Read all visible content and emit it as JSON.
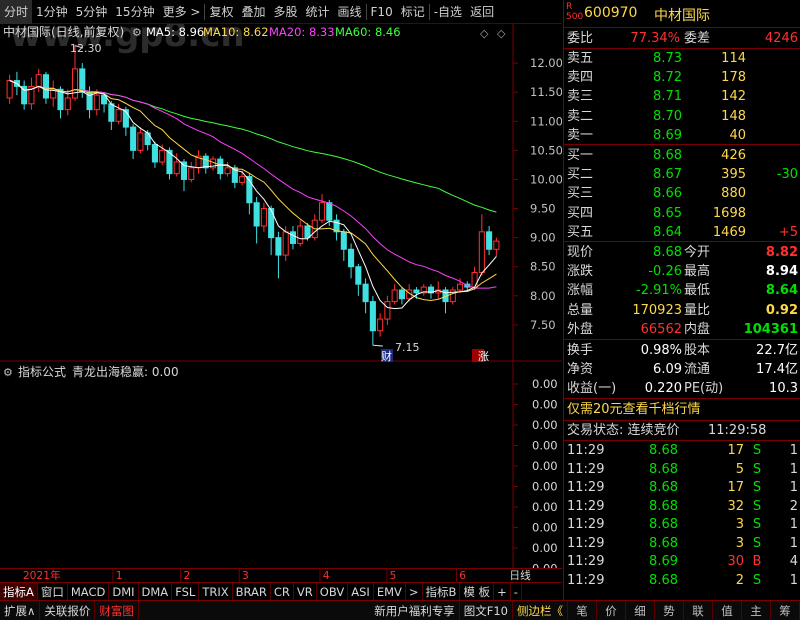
{
  "toolbar": {
    "items": [
      "分时",
      "1分钟",
      "5分钟",
      "15分钟",
      "更多 >",
      "复权",
      "叠加",
      "多股",
      "统计",
      "画线",
      "F10",
      "标记",
      "-自选",
      "返回"
    ]
  },
  "chart_title": {
    "name": "中材国际(日线,前复权)",
    "ma5": "MA5: 8.96",
    "ma10": "MA10: 8.62",
    "ma20": "MA20: 8.33",
    "ma60": "MA60: 8.46",
    "watermark": "www.gp8.cn"
  },
  "colors": {
    "up": "#ff3030",
    "down": "#40e0e0",
    "ma5": "#ffffff",
    "ma10": "#ffd84a",
    "ma20": "#ff40ff",
    "ma60": "#40ff40",
    "grid": "#7a0000"
  },
  "price_axis": [
    "12.00",
    "11.50",
    "11.00",
    "10.50",
    "10.00",
    "9.50",
    "9.00",
    "8.50",
    "8.00",
    "7.50"
  ],
  "annotations": {
    "high": "12.30",
    "low": "7.15",
    "badge_cai": "财",
    "badge_zhang": "涨"
  },
  "indicator": {
    "title": "指标公式",
    "formula": "青龙出海稳赢: 0.00",
    "axis": [
      "0.00",
      "0.00",
      "0.00",
      "0.00",
      "0.00",
      "0.00",
      "0.00",
      "0.00",
      "0.00",
      "0.00"
    ]
  },
  "date_axis": {
    "year": "2021年",
    "months": [
      "1",
      "2",
      "3",
      "4",
      "5",
      "6"
    ],
    "period": "日线"
  },
  "tabs": [
    "指标A",
    "窗口",
    "MACD",
    "DMI",
    "DMA",
    "FSL",
    "TRIX",
    "BRAR",
    "CR",
    "VR",
    "OBV",
    "ASI",
    "EMV",
    ">",
    "指标B",
    "模 板",
    "+",
    "-"
  ],
  "bottombar": {
    "items": [
      "扩展∧",
      "关联报价",
      "财富图"
    ],
    "right_items": [
      "新用户福利专享",
      "图文F10",
      "侧边栏《"
    ],
    "icons": [
      "笔",
      "价",
      "细",
      "势",
      "联",
      "值",
      "主",
      "筹"
    ]
  },
  "quote": {
    "rating_top": "R",
    "rating_bottom": "500",
    "code": "600970",
    "name": "中材国际",
    "weibi_label": "委比",
    "weibi": "77.34%",
    "weicha_label": "委差",
    "weicha": "4246",
    "sells": [
      {
        "label": "卖五",
        "price": "8.73",
        "vol": "114",
        "chg": ""
      },
      {
        "label": "卖四",
        "price": "8.72",
        "vol": "178",
        "chg": ""
      },
      {
        "label": "卖三",
        "price": "8.71",
        "vol": "142",
        "chg": ""
      },
      {
        "label": "卖二",
        "price": "8.70",
        "vol": "148",
        "chg": ""
      },
      {
        "label": "卖一",
        "price": "8.69",
        "vol": "40",
        "chg": ""
      }
    ],
    "buys": [
      {
        "label": "买一",
        "price": "8.68",
        "vol": "426",
        "chg": ""
      },
      {
        "label": "买二",
        "price": "8.67",
        "vol": "395",
        "chg": "-30"
      },
      {
        "label": "买三",
        "price": "8.66",
        "vol": "880",
        "chg": ""
      },
      {
        "label": "买四",
        "price": "8.65",
        "vol": "1698",
        "chg": ""
      },
      {
        "label": "买五",
        "price": "8.64",
        "vol": "1469",
        "chg": "+5"
      }
    ],
    "stats": [
      {
        "l1": "现价",
        "v1": "8.68",
        "l2": "今开",
        "v2": "8.82"
      },
      {
        "l1": "涨跌",
        "v1": "-0.26",
        "l2": "最高",
        "v2": "8.94"
      },
      {
        "l1": "涨幅",
        "v1": "-2.91%",
        "l2": "最低",
        "v2": "8.64"
      },
      {
        "l1": "总量",
        "v1": "170923",
        "l2": "量比",
        "v2": "0.92"
      },
      {
        "l1": "外盘",
        "v1": "66562",
        "l2": "内盘",
        "v2": "104361"
      }
    ],
    "fin": [
      {
        "l1": "换手",
        "v1": "0.98%",
        "l2": "股本",
        "v2": "22.7亿"
      },
      {
        "l1": "净资",
        "v1": "6.09",
        "l2": "流通",
        "v2": "17.4亿"
      },
      {
        "l1": "收益(一)",
        "v1": "0.220",
        "l2": "PE(动)",
        "v2": "10.3"
      }
    ],
    "promo": "仅需20元查看千档行情",
    "status_label": "交易状态: 连续竞价",
    "status_time": "11:29:58",
    "ticks": [
      {
        "time": "11:29",
        "price": "8.68",
        "vol": "17",
        "side": "S",
        "n": "1"
      },
      {
        "time": "11:29",
        "price": "8.68",
        "vol": "5",
        "side": "S",
        "n": "1"
      },
      {
        "time": "11:29",
        "price": "8.68",
        "vol": "17",
        "side": "S",
        "n": "1"
      },
      {
        "time": "11:29",
        "price": "8.68",
        "vol": "32",
        "side": "S",
        "n": "2"
      },
      {
        "time": "11:29",
        "price": "8.68",
        "vol": "3",
        "side": "S",
        "n": "1"
      },
      {
        "time": "11:29",
        "price": "8.68",
        "vol": "3",
        "side": "S",
        "n": "1"
      },
      {
        "time": "11:29",
        "price": "8.69",
        "vol": "30",
        "side": "B",
        "n": "4"
      },
      {
        "time": "11:29",
        "price": "8.68",
        "vol": "2",
        "side": "S",
        "n": "1"
      }
    ]
  },
  "chart_data": {
    "type": "candlestick",
    "title": "中材国际(日线,前复权)",
    "xlabel": "",
    "ylabel": "",
    "ylim": [
      7.0,
      12.5
    ],
    "x_ticks": [
      "2021年",
      "1",
      "2",
      "3",
      "4",
      "5",
      "6"
    ],
    "high_label": 12.3,
    "low_label": 7.15,
    "candles": [
      [
        11.4,
        11.7,
        11.8,
        11.3
      ],
      [
        11.7,
        11.6,
        11.85,
        11.45
      ],
      [
        11.6,
        11.3,
        11.7,
        11.2
      ],
      [
        11.3,
        11.6,
        11.75,
        11.2
      ],
      [
        11.6,
        11.8,
        11.9,
        11.5
      ],
      [
        11.8,
        11.4,
        11.85,
        11.3
      ],
      [
        11.4,
        11.55,
        11.7,
        11.25
      ],
      [
        11.55,
        11.2,
        11.6,
        11.05
      ],
      [
        11.2,
        11.4,
        11.55,
        11.1
      ],
      [
        11.4,
        11.9,
        12.3,
        11.35
      ],
      [
        11.9,
        11.5,
        12.0,
        11.4
      ],
      [
        11.5,
        11.2,
        11.6,
        11.05
      ],
      [
        11.2,
        11.45,
        11.55,
        11.1
      ],
      [
        11.45,
        11.3,
        11.5,
        11.15
      ],
      [
        11.3,
        11.0,
        11.35,
        10.85
      ],
      [
        11.0,
        11.2,
        11.3,
        10.95
      ],
      [
        11.2,
        10.9,
        11.25,
        10.75
      ],
      [
        10.9,
        10.5,
        10.95,
        10.35
      ],
      [
        10.5,
        10.8,
        10.9,
        10.45
      ],
      [
        10.8,
        10.6,
        10.85,
        10.5
      ],
      [
        10.6,
        10.3,
        10.65,
        10.2
      ],
      [
        10.3,
        10.5,
        10.6,
        10.25
      ],
      [
        10.5,
        10.1,
        10.55,
        10.0
      ],
      [
        10.1,
        10.3,
        10.45,
        10.05
      ],
      [
        10.3,
        10.0,
        10.35,
        9.8
      ],
      [
        10.0,
        10.2,
        10.3,
        9.95
      ],
      [
        10.2,
        10.4,
        10.5,
        10.1
      ],
      [
        10.4,
        10.2,
        10.45,
        10.1
      ],
      [
        10.2,
        10.35,
        10.4,
        10.15
      ],
      [
        10.35,
        10.1,
        10.4,
        10.0
      ],
      [
        10.1,
        10.2,
        10.3,
        10.05
      ],
      [
        10.2,
        9.95,
        10.25,
        9.85
      ],
      [
        9.95,
        10.05,
        10.15,
        9.9
      ],
      [
        10.05,
        9.6,
        10.1,
        9.4
      ],
      [
        9.6,
        9.2,
        9.7,
        8.9
      ],
      [
        9.2,
        9.5,
        9.6,
        9.1
      ],
      [
        9.5,
        9.0,
        9.55,
        8.7
      ],
      [
        9.0,
        8.7,
        9.1,
        8.3
      ],
      [
        8.7,
        9.1,
        9.2,
        8.6
      ],
      [
        9.1,
        8.9,
        9.2,
        8.8
      ],
      [
        8.9,
        9.2,
        9.3,
        8.85
      ],
      [
        9.2,
        9.0,
        9.25,
        8.95
      ],
      [
        9.0,
        9.3,
        9.4,
        8.95
      ],
      [
        9.3,
        9.6,
        9.75,
        9.25
      ],
      [
        9.6,
        9.3,
        9.65,
        9.2
      ],
      [
        9.3,
        9.1,
        9.4,
        8.95
      ],
      [
        9.1,
        8.8,
        9.15,
        8.6
      ],
      [
        8.8,
        8.5,
        8.9,
        8.3
      ],
      [
        8.5,
        8.2,
        8.55,
        8.0
      ],
      [
        8.2,
        7.9,
        8.3,
        7.7
      ],
      [
        7.9,
        7.4,
        8.0,
        7.15
      ],
      [
        7.4,
        7.6,
        7.7,
        7.3
      ],
      [
        7.6,
        7.9,
        8.0,
        7.5
      ],
      [
        7.9,
        8.1,
        8.2,
        7.85
      ],
      [
        8.1,
        7.95,
        8.15,
        7.85
      ],
      [
        7.95,
        8.1,
        8.2,
        7.9
      ],
      [
        8.1,
        8.05,
        8.15,
        7.95
      ],
      [
        8.05,
        8.15,
        8.2,
        8.0
      ],
      [
        8.15,
        8.05,
        8.2,
        7.95
      ],
      [
        8.05,
        8.1,
        8.25,
        7.95
      ],
      [
        8.1,
        7.9,
        8.15,
        7.7
      ],
      [
        7.9,
        8.1,
        8.15,
        7.85
      ],
      [
        8.1,
        8.2,
        8.3,
        8.05
      ],
      [
        8.2,
        8.15,
        8.25,
        8.1
      ],
      [
        8.15,
        8.4,
        8.5,
        8.1
      ],
      [
        8.4,
        9.1,
        9.4,
        8.35
      ],
      [
        9.1,
        8.8,
        9.2,
        8.7
      ],
      [
        8.8,
        8.94,
        9.0,
        8.68
      ]
    ],
    "series": [
      {
        "name": "MA5",
        "last": 8.96
      },
      {
        "name": "MA10",
        "last": 8.62
      },
      {
        "name": "MA20",
        "last": 8.33
      },
      {
        "name": "MA60",
        "last": 8.46
      }
    ]
  }
}
